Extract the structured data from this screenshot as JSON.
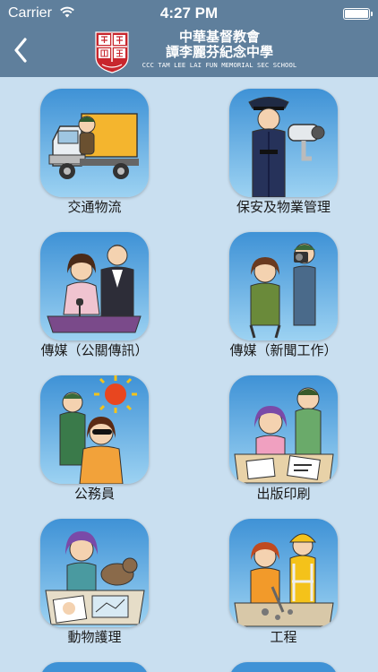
{
  "status_bar": {
    "carrier": "Carrier",
    "time": "4:27 PM"
  },
  "header": {
    "school_name_line1": "中華基督教會",
    "school_name_line2": "譚李麗芬紀念中學",
    "school_name_english": "CCC TAM LEE LAI FUN MEMORIAL SEC SCHOOL",
    "bar_color": "#5f7f9c"
  },
  "careers": [
    {
      "label": "交通物流",
      "icon": "truck-driver-icon"
    },
    {
      "label": "保安及物業管理",
      "icon": "security-guard-icon"
    },
    {
      "label": "傳媒（公關傳訊）",
      "icon": "public-relations-icon"
    },
    {
      "label": "傳媒（新聞工作）",
      "icon": "journalist-icon"
    },
    {
      "label": "公務員",
      "icon": "civil-servant-icon"
    },
    {
      "label": "出版印刷",
      "icon": "publishing-icon"
    },
    {
      "label": "動物護理",
      "icon": "animal-care-icon"
    },
    {
      "label": "工程",
      "icon": "engineering-icon"
    }
  ]
}
